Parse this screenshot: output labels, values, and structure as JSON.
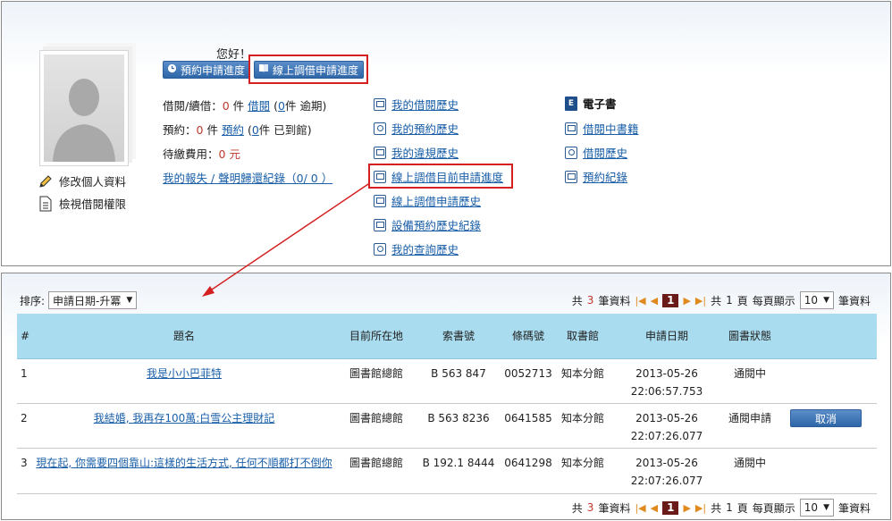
{
  "profile": {
    "edit_label": "修改個人資料",
    "permission_label": "檢視借閱權限"
  },
  "greeting": "您好！",
  "buttons": {
    "reserve_progress": "預約申請進度",
    "online_progress": "線上調借申請進度"
  },
  "stats": {
    "borrow_label": "借閱/續借：",
    "borrow_count": "0",
    "borrow_unit": "件",
    "borrow_link": "借閱",
    "borrow_overdue_prefix": "(",
    "borrow_overdue_count": "0",
    "borrow_overdue_suffix": "件 逾期)",
    "reserve_label": "預約：",
    "reserve_count": "0",
    "reserve_unit": "件",
    "reserve_link": "預約",
    "reserve_arrived_prefix": "(",
    "reserve_arrived_count": "0",
    "reserve_arrived_suffix": "件 已到館)",
    "fee_label": "待繳費用：",
    "fee_value": "0",
    "fee_unit": "元",
    "lost_link": "我的報失 / 聲明歸還紀錄（0/ 0 ）"
  },
  "mid_links": [
    "我的借閱歷史",
    "我的預約歷史",
    "我的違規歷史",
    "線上調借目前申請進度",
    "線上調借申請歷史",
    "設備預約歷史紀錄",
    "我的查詢歷史"
  ],
  "ebook": {
    "title": "電子書",
    "links": [
      "借閱中書籍",
      "借閱歷史",
      "預約紀錄"
    ]
  },
  "list": {
    "sort_label": "排序:",
    "sort_value": "申請日期-升冪",
    "pager": {
      "total_prefix": "共",
      "total_count": "3",
      "total_suffix": "筆資料",
      "current_page": "1",
      "pages_prefix": "共",
      "pages_count": "1",
      "pages_suffix": "頁",
      "per_page_label": "每頁顯示",
      "per_page_value": "10",
      "per_page_suffix": "筆資料"
    },
    "columns": [
      "#",
      "題名",
      "目前所在地",
      "索書號",
      "條碼號",
      "取書館",
      "申請日期",
      "圖書狀態",
      ""
    ],
    "rows": [
      {
        "idx": "1",
        "title": "我是小小巴菲特",
        "location": "圖書館總館",
        "call_no": "B 563 847",
        "barcode": "0052713",
        "pickup": "知本分館",
        "date": "2013-05-26",
        "time": "22:06:57.753",
        "status": "通閱中",
        "action": ""
      },
      {
        "idx": "2",
        "title": "我結婚, 我再存100萬:白雪公主理財記",
        "location": "圖書館總館",
        "call_no": "B 563 8236",
        "barcode": "0641585",
        "pickup": "知本分館",
        "date": "2013-05-26",
        "time": "22:07:26.077",
        "status": "通閱申請",
        "action": "取消"
      },
      {
        "idx": "3",
        "title": "現在起, 你需要四個靠山:這樣的生活方式, 任何不順都打不倒你",
        "location": "圖書館總館",
        "call_no": "B 192.1 8444",
        "barcode": "0641298",
        "pickup": "知本分館",
        "date": "2013-05-26",
        "time": "22:07:26.077",
        "status": "通閱中",
        "action": ""
      }
    ]
  },
  "colors": {
    "accent_blue": "#2e66a8",
    "header_cyan": "#a9dcef",
    "highlight_red": "#d42020",
    "link": "#1a5fa8"
  }
}
